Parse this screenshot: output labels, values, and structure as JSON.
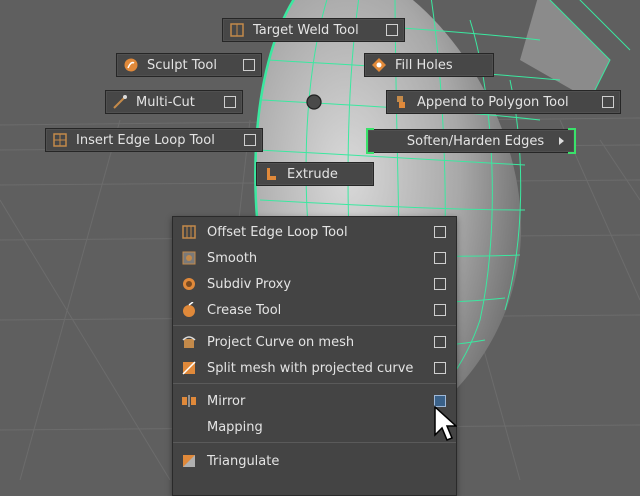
{
  "marking_menu": {
    "north": {
      "label": "Target Weld Tool",
      "icon": "target-weld-icon"
    },
    "northwest": {
      "label": "Sculpt Tool",
      "icon": "sculpt-icon"
    },
    "northeast": {
      "label": "Fill Holes",
      "icon": "fill-holes-icon"
    },
    "west_upper": {
      "label": "Multi-Cut",
      "icon": "multi-cut-icon"
    },
    "east_upper": {
      "label": "Append to Polygon Tool",
      "icon": "append-polygon-icon"
    },
    "west": {
      "label": "Insert Edge Loop Tool",
      "icon": "insert-edge-loop-icon"
    },
    "east": {
      "label": "Soften/Harden Edges",
      "icon": "chevron-right-icon"
    },
    "south": {
      "label": "Extrude",
      "icon": "extrude-icon"
    }
  },
  "menu": {
    "group1": [
      {
        "label": "Offset Edge Loop Tool",
        "icon": "offset-edge-loop-icon"
      },
      {
        "label": "Smooth",
        "icon": "smooth-icon"
      },
      {
        "label": "Subdiv Proxy",
        "icon": "subdiv-proxy-icon"
      },
      {
        "label": "Crease Tool",
        "icon": "crease-icon"
      }
    ],
    "group2": [
      {
        "label": "Project Curve on mesh",
        "icon": "project-curve-icon"
      },
      {
        "label": "Split mesh with projected curve",
        "icon": "split-mesh-icon"
      }
    ],
    "group3": [
      {
        "label": "Mirror",
        "icon": "mirror-icon"
      },
      {
        "label": "Mapping",
        "icon": ""
      }
    ],
    "group4": [
      {
        "label": "Triangulate",
        "icon": "triangulate-icon"
      }
    ]
  },
  "colors": {
    "viewport_bg": "#5f5f5f",
    "wireframe": "#3be8a0",
    "highlight_bracket": "#39e26a",
    "menu_bg": "#444444"
  }
}
